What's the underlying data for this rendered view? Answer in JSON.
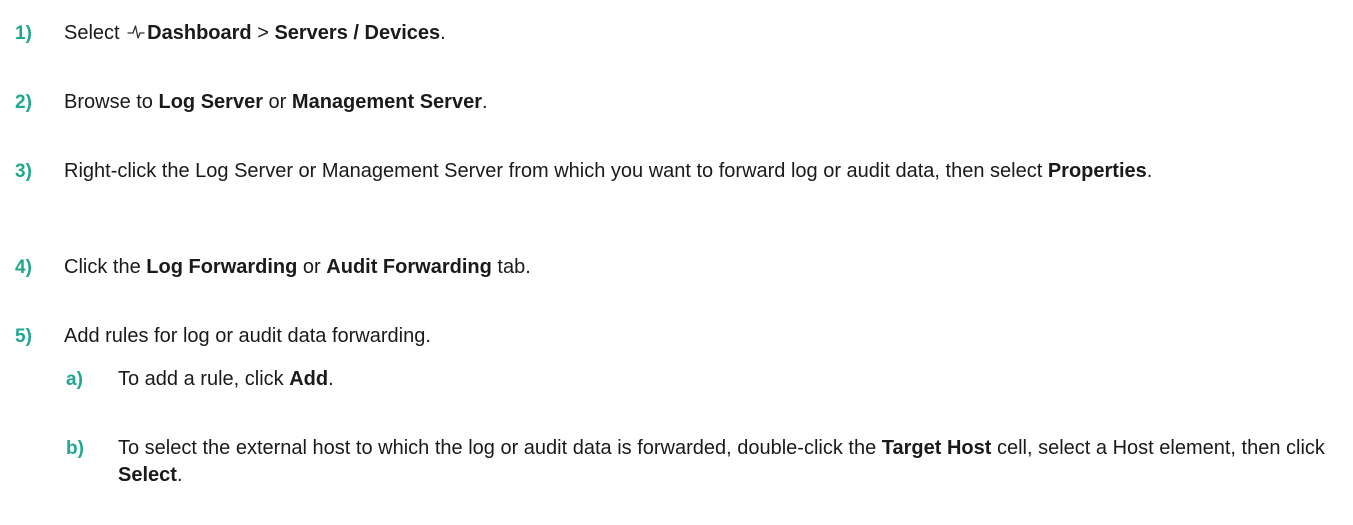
{
  "steps": [
    {
      "number": "1)",
      "parts": [
        "Select",
        "Dashboard",
        ">",
        "Servers / Devices",
        "."
      ],
      "icon": "activity-pulse-icon"
    },
    {
      "number": "2)",
      "parts": [
        "Browse to",
        "Log Server",
        "or",
        "Management Server",
        "."
      ]
    },
    {
      "number": "3)",
      "parts": [
        "Right-click the Log Server or Management Server from which you want to forward log or audit data, then select",
        "Properties",
        "."
      ]
    },
    {
      "number": "4)",
      "parts": [
        "Click the",
        "Log Forwarding",
        "or",
        "Audit Forwarding",
        "tab."
      ]
    },
    {
      "number": "5)",
      "parts": [
        "Add rules for log or audit data forwarding."
      ],
      "substeps": [
        {
          "number": "a)",
          "parts": [
            "To add a rule, click",
            "Add",
            "."
          ]
        },
        {
          "number": "b)",
          "parts": [
            "To select the external host to which the log or audit data is forwarded, double-click the",
            "Target Host",
            "cell, select a Host element, then click",
            "Select",
            "."
          ]
        }
      ]
    }
  ],
  "colors": {
    "step_number": "#1fa78f",
    "text": "#1a1a1a"
  }
}
